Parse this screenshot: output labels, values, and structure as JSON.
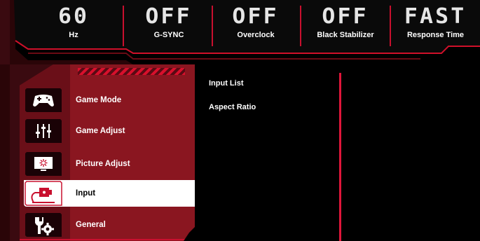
{
  "status_bar": [
    {
      "value": "60",
      "label": "Hz"
    },
    {
      "value": "OFF",
      "label": "G-SYNC"
    },
    {
      "value": "OFF",
      "label": "Overclock"
    },
    {
      "value": "OFF",
      "label": "Black Stabilizer"
    },
    {
      "value": "FAST",
      "label": "Response Time"
    }
  ],
  "menu": {
    "items": [
      {
        "label": "Game Mode",
        "icon": "gamepad-icon"
      },
      {
        "label": "Game Adjust",
        "icon": "sliders-icon"
      },
      {
        "label": "Picture Adjust",
        "icon": "monitor-brightness-icon"
      },
      {
        "label": "Input",
        "icon": "input-plug-icon",
        "selected": true
      },
      {
        "label": "General",
        "icon": "gear-wrench-icon"
      }
    ]
  },
  "submenu": {
    "items": [
      {
        "label": "Input List"
      },
      {
        "label": "Aspect Ratio"
      }
    ]
  },
  "colors": {
    "accent": "#e0163a",
    "panel": "#8a1620",
    "panel_dark": "#3a0a10",
    "background": "#000000"
  }
}
